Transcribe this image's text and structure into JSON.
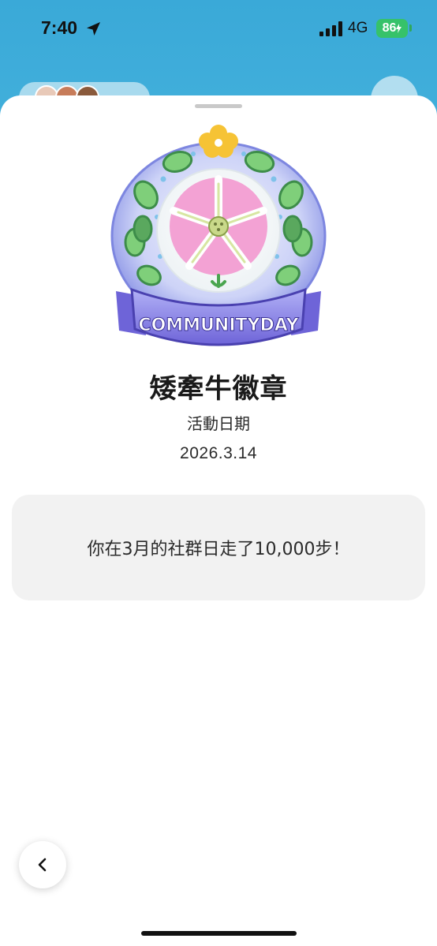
{
  "status_bar": {
    "time": "7:40",
    "network": "4G",
    "battery": "86",
    "icons": [
      "location-arrow-icon",
      "signal-bars-icon",
      "charging-bolt-icon"
    ]
  },
  "badge": {
    "image_text": "COMMUNITYDAY",
    "title": "矮牽牛徽章",
    "date_label": "活動日期",
    "date": "2026.3.14"
  },
  "message": {
    "text": "你在3月的社群日走了10,000步！"
  },
  "navigation": {
    "back_icon": "chevron-left-icon"
  },
  "colors": {
    "sheet": "#ffffff",
    "card": "#f2f2f2",
    "battery": "#36c26a",
    "ribbon": "#8d86ea"
  }
}
